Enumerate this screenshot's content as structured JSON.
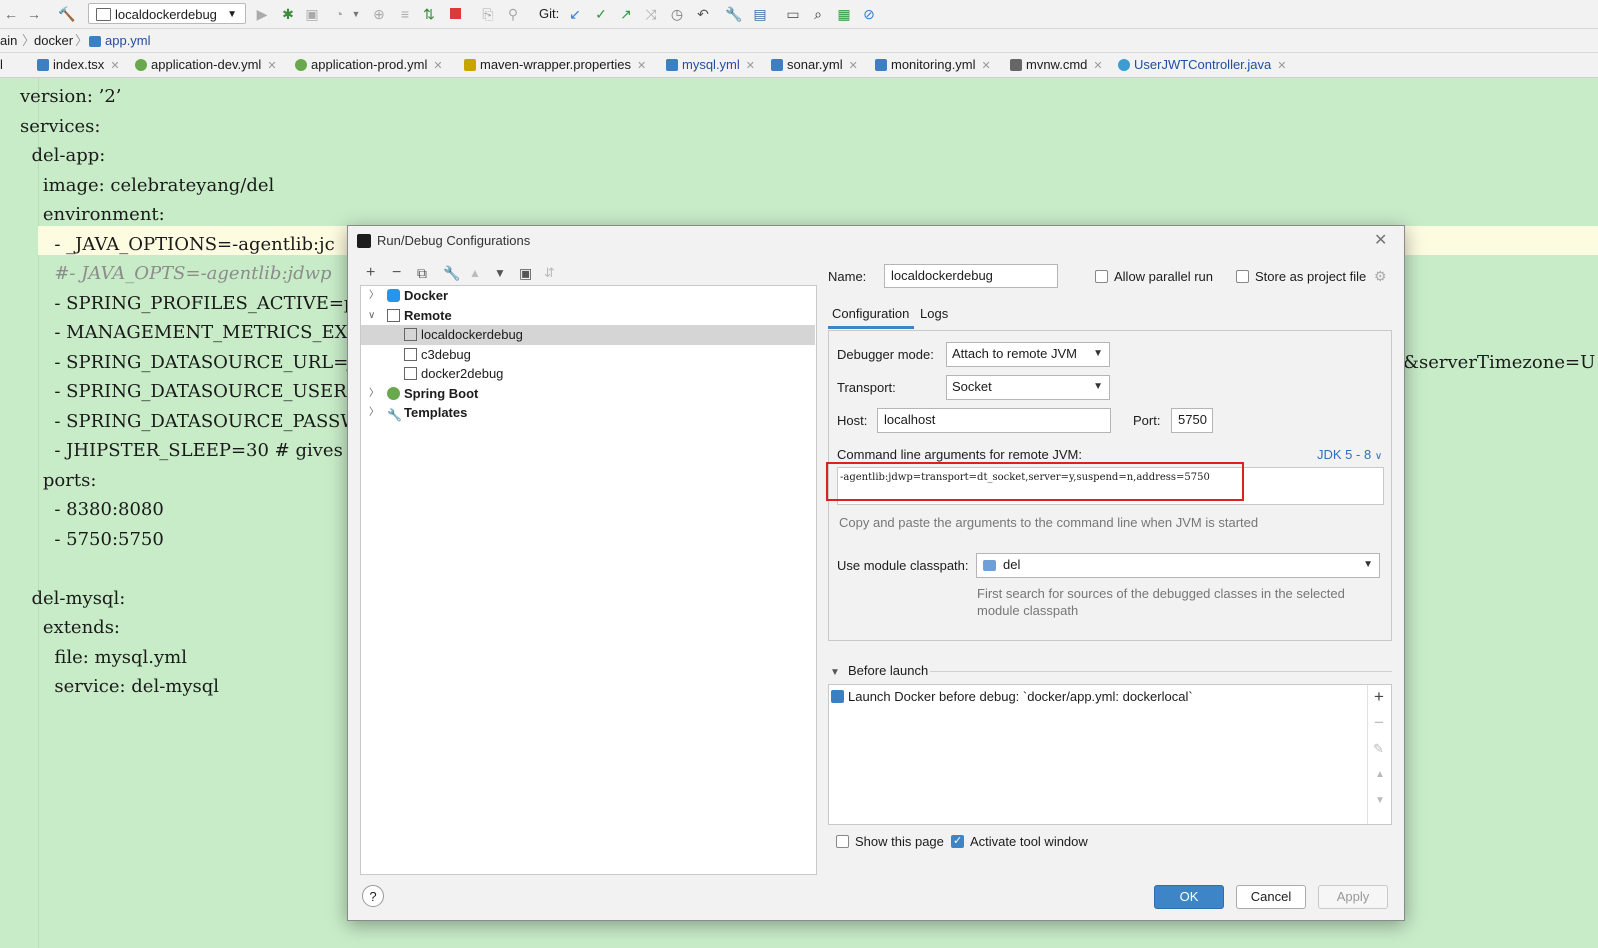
{
  "toolbar": {
    "run_config": "localdockerdebug",
    "git_label": "Git:"
  },
  "breadcrumbs": {
    "items": [
      "ain",
      "docker",
      "app.yml"
    ]
  },
  "tabs": [
    {
      "label": "l",
      "color": "#f0a030"
    },
    {
      "label": "index.tsx",
      "color": "#3b7fc4"
    },
    {
      "label": "application-dev.yml",
      "color": "#6aa84f"
    },
    {
      "label": "application-prod.yml",
      "color": "#6aa84f"
    },
    {
      "label": "maven-wrapper.properties",
      "color": "#888888"
    },
    {
      "label": "mysql.yml",
      "color": "#3b7fc4"
    },
    {
      "label": "sonar.yml",
      "color": "#3b7fc4"
    },
    {
      "label": "monitoring.yml",
      "color": "#3b7fc4"
    },
    {
      "label": "mvnw.cmd",
      "color": "#666666"
    },
    {
      "label": "UserJWTController.java",
      "color": "#3d9cd1"
    }
  ],
  "editor": {
    "lines": [
      "version: ’2’",
      "services:",
      "  del-app:",
      "    image: celebrateyang/del",
      "    environment:",
      "      - _JAVA_OPTIONS=-agentlib:jc",
      "      #- JAVA_OPTS=-agentlib:jdwp",
      "      - SPRING_PROFILES_ACTIVE=pro",
      "      - MANAGEMENT_METRICS_EXPORT_",
      "      - SPRING_DATASOURCE_URL=jdbc",
      "      - SPRING_DATASOURCE_USER=roo",
      "      - SPRING_DATASOURCE_PASSWORI",
      "      - JHIPSTER_SLEEP=30 # gives",
      "    ports:",
      "      - 8380:8080",
      "      - 5750:5750",
      "",
      "  del-mysql:",
      "    extends:",
      "      file: mysql.yml",
      "      service: del-mysql"
    ],
    "overflow_right": "&serverTimezone=U"
  },
  "dialog": {
    "title": "Run/Debug Configurations",
    "tree": [
      {
        "label": "Docker",
        "level": 0,
        "bold": true,
        "expanded": false
      },
      {
        "label": "Remote",
        "level": 0,
        "bold": true,
        "expanded": true
      },
      {
        "label": "localdockerdebug",
        "level": 1,
        "bold": false,
        "selected": true
      },
      {
        "label": "c3debug",
        "level": 1,
        "bold": false
      },
      {
        "label": "docker2debug",
        "level": 1,
        "bold": false
      },
      {
        "label": "Spring Boot",
        "level": 0,
        "bold": true,
        "expanded": false
      },
      {
        "label": "Templates",
        "level": 0,
        "bold": true,
        "expanded": false
      }
    ],
    "name_label": "Name:",
    "name_value": "localdockerdebug",
    "allow_parallel": "Allow parallel run",
    "store_as_project": "Store as project file",
    "tab_configuration": "Configuration",
    "tab_logs": "Logs",
    "debugger_mode_label": "Debugger mode:",
    "debugger_mode_value": "Attach to remote JVM",
    "transport_label": "Transport:",
    "transport_value": "Socket",
    "host_label": "Host:",
    "host_value": "localhost",
    "port_label": "Port:",
    "port_value": "5750",
    "cmdline_label": "Command line arguments for remote JVM:",
    "jdk_link": "JDK 5 - 8",
    "cmdline_value": "-agentlib:jdwp=transport=dt_socket,server=y,suspend=n,address=5750",
    "cmdline_hint": "Copy and paste the arguments to the command line when JVM is started",
    "module_label": "Use module classpath:",
    "module_value": "del",
    "module_hint_1": "First search for sources of the debugged classes in the selected",
    "module_hint_2": "module classpath",
    "before_launch": "Before launch",
    "before_item": "Launch Docker before debug: `docker/app.yml: dockerlocal`",
    "show_page": "Show this page",
    "activate_tool": "Activate tool window",
    "ok": "OK",
    "cancel": "Cancel",
    "apply": "Apply",
    "help": "?"
  },
  "colors": {
    "accent": "#3d85c6",
    "highlight_box": "#e02020",
    "editor_bg": "#c8ecc8"
  }
}
